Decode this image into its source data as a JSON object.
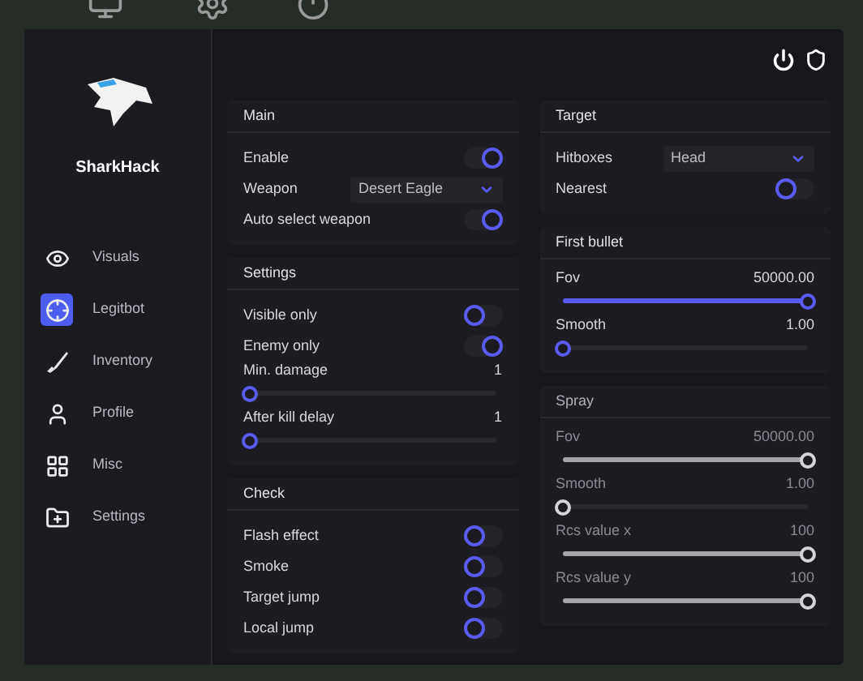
{
  "brand": {
    "name": "SharkHack"
  },
  "nav": [
    {
      "label": "Visuals",
      "selected": false
    },
    {
      "label": "Legitbot",
      "selected": true
    },
    {
      "label": "Inventory",
      "selected": false
    },
    {
      "label": "Profile",
      "selected": false
    },
    {
      "label": "Misc",
      "selected": false
    },
    {
      "label": "Settings",
      "selected": false
    }
  ],
  "columns": [
    [
      {
        "title": "Main",
        "disabled": false,
        "rows": [
          {
            "kind": "toggle",
            "label": "Enable",
            "on": true
          },
          {
            "kind": "select",
            "label": "Weapon",
            "value": "Desert Eagle"
          },
          {
            "kind": "toggle",
            "label": "Auto select weapon",
            "on": true
          }
        ]
      },
      {
        "title": "Settings",
        "disabled": false,
        "rows": [
          {
            "kind": "toggle",
            "label": "Visible only",
            "on": false
          },
          {
            "kind": "toggle",
            "label": "Enemy only",
            "on": true
          },
          {
            "kind": "slider",
            "label": "Min. damage",
            "reading": "1",
            "level": 0
          },
          {
            "kind": "slider",
            "label": "After kill delay",
            "reading": "1",
            "level": 0
          }
        ]
      },
      {
        "title": "Check",
        "disabled": false,
        "rows": [
          {
            "kind": "toggle",
            "label": "Flash effect",
            "on": false
          },
          {
            "kind": "toggle",
            "label": "Smoke",
            "on": false
          },
          {
            "kind": "toggle",
            "label": "Target jump",
            "on": false
          },
          {
            "kind": "toggle",
            "label": "Local jump",
            "on": false
          }
        ]
      }
    ],
    [
      {
        "title": "Target",
        "disabled": false,
        "rows": [
          {
            "kind": "select",
            "label": "Hitboxes",
            "value": "Head"
          },
          {
            "kind": "toggle",
            "label": "Nearest",
            "on": false
          }
        ]
      },
      {
        "title": "First bullet",
        "disabled": false,
        "rows": [
          {
            "kind": "slider",
            "label": "Fov",
            "reading": "50000.00",
            "level": 1
          },
          {
            "kind": "slider",
            "label": "Smooth",
            "reading": "1.00",
            "level": 0
          }
        ]
      },
      {
        "title": "Spray",
        "disabled": true,
        "rows": [
          {
            "kind": "slider",
            "label": "Fov",
            "reading": "50000.00",
            "level": 1
          },
          {
            "kind": "slider",
            "label": "Smooth",
            "reading": "1.00",
            "level": 0
          },
          {
            "kind": "slider",
            "label": "Rcs value x",
            "reading": "100",
            "level": 1
          },
          {
            "kind": "slider",
            "label": "Rcs value y",
            "reading": "100",
            "level": 1
          }
        ]
      }
    ]
  ]
}
